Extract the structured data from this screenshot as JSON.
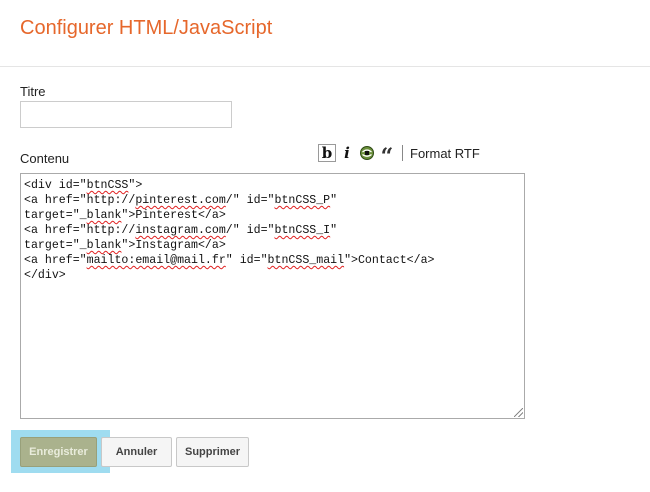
{
  "header": {
    "title": "Configurer HTML/JavaScript"
  },
  "form": {
    "titre_label": "Titre",
    "titre_value": "",
    "contenu_label": "Contenu"
  },
  "toolbar": {
    "bold_glyph": "b",
    "italic_glyph": "i",
    "link_icon": "link-icon",
    "quote_glyph": "“",
    "rtf_label": "Format RTF"
  },
  "editor": {
    "lines": [
      [
        {
          "t": "<div id=\""
        },
        {
          "t": "btnCSS",
          "sp": true
        },
        {
          "t": "\">"
        }
      ],
      [
        {
          "t": "<a href=\"http://"
        },
        {
          "t": "pinterest.com",
          "sp": true
        },
        {
          "t": "/\" id=\""
        },
        {
          "t": "btnCSS_P",
          "sp": true
        },
        {
          "t": "\""
        }
      ],
      [
        {
          "t": "target=\"_"
        },
        {
          "t": "blank",
          "sp": true
        },
        {
          "t": "\">Pinterest</a>"
        }
      ],
      [
        {
          "t": "<a href=\"http://"
        },
        {
          "t": "instagram.com",
          "sp": true
        },
        {
          "t": "/\" id=\""
        },
        {
          "t": "btnCSS_I",
          "sp": true
        },
        {
          "t": "\""
        }
      ],
      [
        {
          "t": "target=\"_"
        },
        {
          "t": "blank",
          "sp": true
        },
        {
          "t": "\">Instagram</a>"
        }
      ],
      [
        {
          "t": "<a href=\""
        },
        {
          "t": "mailto:email@mail.fr",
          "sp": true
        },
        {
          "t": "\" id=\""
        },
        {
          "t": "btnCSS_mail",
          "sp": true
        },
        {
          "t": "\">Contact</a>"
        }
      ],
      [
        {
          "t": "</div>"
        }
      ]
    ]
  },
  "actions": {
    "save_label": "Enregistrer",
    "cancel_label": "Annuler",
    "delete_label": "Supprimer"
  },
  "colors": {
    "title": "#e6672b",
    "save_button": "#aab28d",
    "focus_highlight": "#9fdcf0"
  }
}
